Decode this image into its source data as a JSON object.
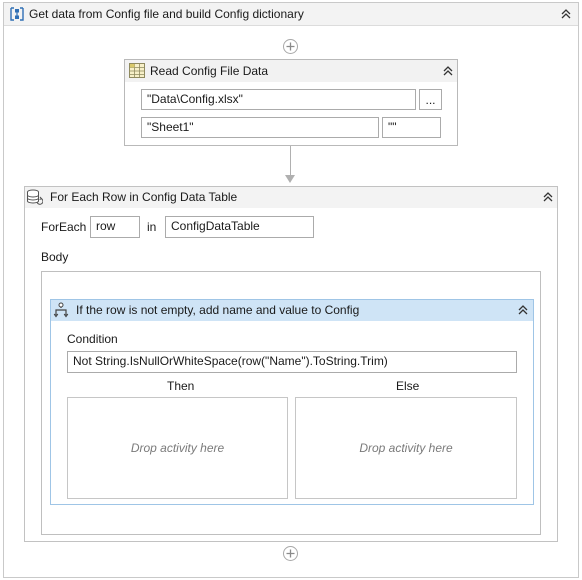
{
  "sequence": {
    "title": "Get data from Config file and build Config dictionary"
  },
  "read_config": {
    "title": "Read Config File Data",
    "workbook_path": "\"Data\\Config.xlsx\"",
    "browse_label": "...",
    "sheet_name": "\"Sheet1\"",
    "range": "\"\""
  },
  "for_each": {
    "title": "For Each Row in Config Data Table",
    "foreach_label": "ForEach",
    "item_var": "row",
    "in_label": "in",
    "collection": "ConfigDataTable",
    "body_label": "Body"
  },
  "if_activity": {
    "title": "If the row is not empty, add name and value to Config",
    "condition_label": "Condition",
    "condition": "Not String.IsNullOrWhiteSpace(row(\"Name\").ToString.Trim)",
    "then_label": "Then",
    "else_label": "Else",
    "then_drop": "Drop activity here",
    "else_drop": "Drop activity here"
  },
  "colors": {
    "header_gray": "#f3f3f3",
    "if_header_blue": "#cfe4f6",
    "if_border_blue": "#9fc5e6",
    "sequence_icon_blue": "#2f6fb5"
  }
}
